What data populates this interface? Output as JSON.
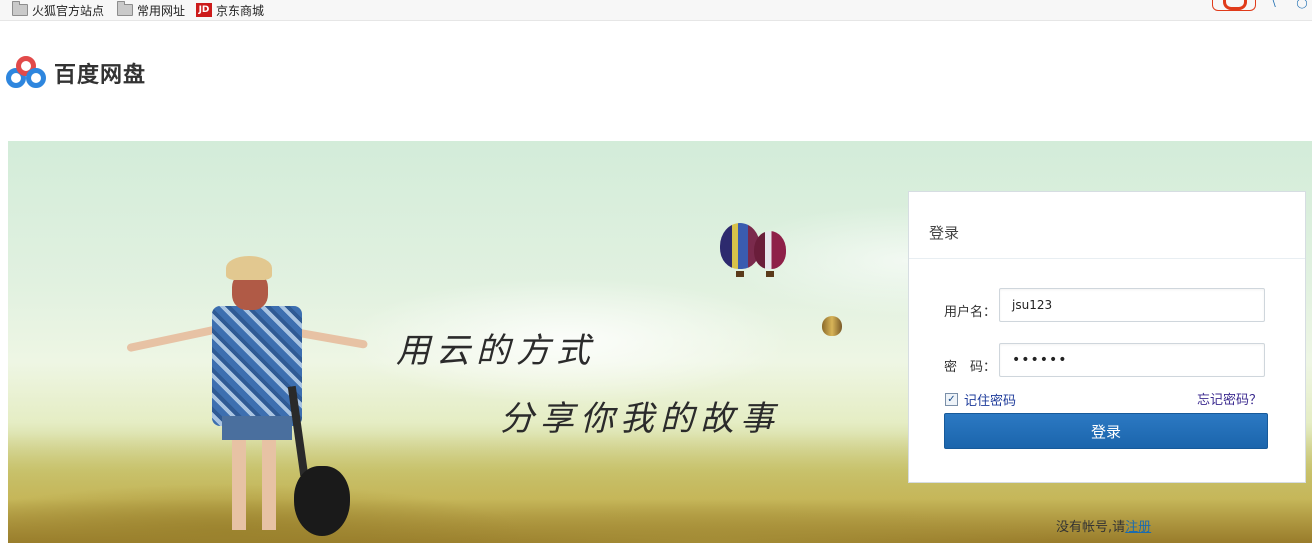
{
  "bookmarks": [
    {
      "label": "火狐官方站点",
      "icon": "folder-icon"
    },
    {
      "label": "常用网址",
      "icon": "folder-icon"
    },
    {
      "label": "京东商城",
      "icon": "jd-icon",
      "icon_text": "JD"
    }
  ],
  "logo": {
    "text": "百度网盘",
    "icon": "baidu-netdisk-logo-icon"
  },
  "banner": {
    "slogan_line1": "用云的方式",
    "slogan_line2": "分享你我的故事"
  },
  "login": {
    "title": "登录",
    "username_label": "用户名：",
    "username_value": "jsu123",
    "password_label": "密　码：",
    "password_value": "••••••",
    "remember_label": "记住密码",
    "remember_checked": true,
    "forgot_label": "忘记密码？",
    "submit_label": "登录"
  },
  "register": {
    "prompt": "没有帐号,请",
    "link": "注册"
  },
  "colors": {
    "accent": "#1b65ac",
    "link": "#1a6bb0",
    "brand_blue": "#2e86de"
  }
}
